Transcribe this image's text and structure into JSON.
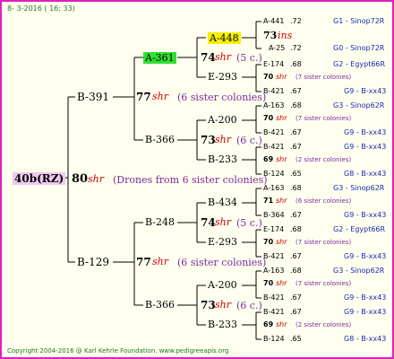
{
  "header": {
    "date": "8- 3-2016 ( 16: 33)"
  },
  "footer": {
    "copyright": "Copyright 2004-2016 @ Karl Kehrle Foundation.   www.pedigreeapis.org"
  },
  "tree": {
    "root": {
      "id": "40b(RZ)"
    },
    "root_mating": {
      "num": "80",
      "shr": "shr",
      "note": "(Drones from 6 sister colonies)"
    },
    "sire": {
      "id": "B-391",
      "mating": {
        "num": "77",
        "shr": "shr",
        "note": "(6 sister colonies)"
      },
      "q1": {
        "id": "A-361",
        "mating": {
          "num": "74",
          "shr": "shr",
          "note": "(5 c.)"
        },
        "q1": {
          "id": "A-448",
          "mating": {
            "num": "73",
            "shr": "ins"
          },
          "q": {
            "id": "A-441",
            "val": ".72",
            "src": "G1 - Sinop72R"
          },
          "d": {
            "id": "A-25",
            "val": ".72",
            "src": "G0 - Sinop72R"
          }
        },
        "q2": {
          "id": "E-293",
          "mating": {
            "num": "70",
            "shr": "shr",
            "note": "(7 sister colonies)"
          },
          "q": {
            "id": "E-174",
            "val": ".68",
            "src": "G2 - Egypt66R"
          },
          "d": {
            "id": "B-421",
            "val": ".67",
            "src": "G9 - B-xx43"
          }
        }
      },
      "q2": {
        "id": "B-366",
        "mating": {
          "num": "73",
          "shr": "shr",
          "note": "(6 c.)"
        },
        "q1": {
          "id": "A-200",
          "mating": {
            "num": "70",
            "shr": "shr",
            "note": "(7 sister colonies)"
          },
          "q": {
            "id": "A-163",
            "val": ".68",
            "src": "G3 - Sinop62R"
          },
          "d": {
            "id": "B-421",
            "val": ".67",
            "src": "G9 - B-xx43"
          }
        },
        "q2": {
          "id": "B-233",
          "mating": {
            "num": "69",
            "shr": "shr",
            "note": "(2 sister colonies)"
          },
          "q": {
            "id": "B-421",
            "val": ".67",
            "src": "G9 - B-xx43"
          },
          "d": {
            "id": "B-124",
            "val": ".65",
            "src": "G8 - B-xx43"
          }
        }
      }
    },
    "dam": {
      "id": "B-129",
      "mating": {
        "num": "77",
        "shr": "shr",
        "note": "(6 sister colonies)"
      },
      "q1": {
        "id": "B-248",
        "mating": {
          "num": "74",
          "shr": "shr",
          "note": "(5 c.)"
        },
        "q1": {
          "id": "B-434",
          "mating": {
            "num": "71",
            "shr": "shr",
            "note": "(6 sister colonies)"
          },
          "q": {
            "id": "A-163",
            "val": ".68",
            "src": "G3 - Sinop62R"
          },
          "d": {
            "id": "B-364",
            "val": ".67",
            "src": "G9 - B-xx43"
          }
        },
        "q2": {
          "id": "E-293",
          "mating": {
            "num": "70",
            "shr": "shr",
            "note": "(7 sister colonies)"
          },
          "q": {
            "id": "E-174",
            "val": ".68",
            "src": "G2 - Egypt66R"
          },
          "d": {
            "id": "B-421",
            "val": ".67",
            "src": "G9 - B-xx43"
          }
        }
      },
      "q2": {
        "id": "B-366",
        "mating": {
          "num": "73",
          "shr": "shr",
          "note": "(6 c.)"
        },
        "q1": {
          "id": "A-200",
          "mating": {
            "num": "70",
            "shr": "shr",
            "note": "(7 sister colonies)"
          },
          "q": {
            "id": "A-163",
            "val": ".68",
            "src": "G3 - Sinop62R"
          },
          "d": {
            "id": "B-421",
            "val": ".67",
            "src": "G9 - B-xx43"
          }
        },
        "q2": {
          "id": "B-233",
          "mating": {
            "num": "69",
            "shr": "shr",
            "note": "(2 sister colonies)"
          },
          "q": {
            "id": "B-421",
            "val": ".67",
            "src": "G9 - B-xx43"
          },
          "d": {
            "id": "B-124",
            "val": ".65",
            "src": "G8 - B-xx43"
          }
        }
      }
    }
  }
}
